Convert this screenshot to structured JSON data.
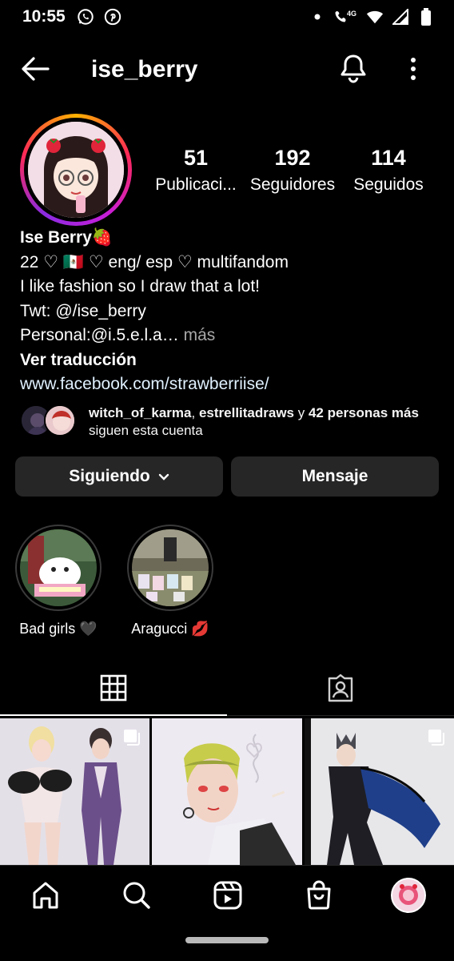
{
  "status_bar": {
    "time": "10:55",
    "left_icons": [
      "whatsapp-icon",
      "pinterest-icon"
    ],
    "right_icons": [
      "dot-icon",
      "wifi-call-icon",
      "wifi-icon",
      "signal-icon",
      "battery-icon"
    ],
    "network": "4G"
  },
  "header": {
    "username": "ise_berry"
  },
  "profile": {
    "stats": [
      {
        "value": "51",
        "label": "Publicaci..."
      },
      {
        "value": "192",
        "label": "Seguidores"
      },
      {
        "value": "114",
        "label": "Seguidos"
      }
    ],
    "name": "Ise Berry🍓",
    "bio_lines": [
      "22 ♡ 🇲🇽 ♡ eng/ esp ♡ multifandom",
      "I like fashion so I draw that a lot!",
      "Twt: @/ise_berry"
    ],
    "bio_truncated": "Personal:@i.5.e.l.a…",
    "more_label": " más",
    "translate_label": "Ver traducción",
    "website": "www.facebook.com/strawberriise/"
  },
  "followed_by": {
    "user1": "witch_of_karma",
    "sep": ", ",
    "user2": "estrellitadraws",
    "conj": " y ",
    "others": "42 personas más",
    "suffix": " siguen esta cuenta"
  },
  "buttons": {
    "following": "Siguiendo",
    "message": "Mensaje"
  },
  "highlights": [
    {
      "label": "Bad girls 🖤"
    },
    {
      "label": "Aragucci 💋"
    }
  ],
  "colors": {
    "background": "#000000",
    "button_bg": "#262626",
    "muted": "#a8a8a8",
    "link": "#e0f1ff"
  }
}
